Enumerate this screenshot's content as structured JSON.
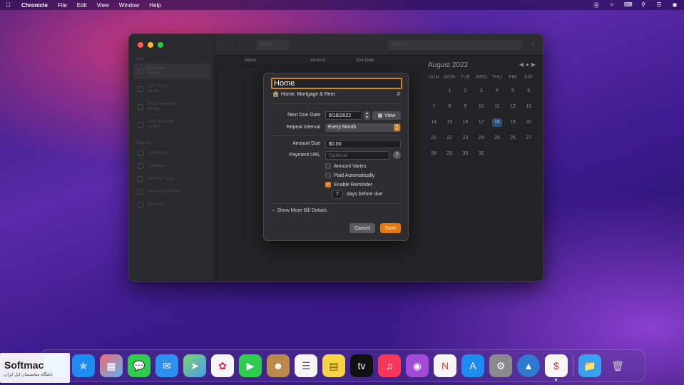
{
  "menubar": {
    "app_name": "Chronicle",
    "items": [
      "File",
      "Edit",
      "View",
      "Window",
      "Help"
    ]
  },
  "sidebar": {
    "section_bills": "Bills",
    "items": [
      {
        "label": "Overdue",
        "sub": "No Bills"
      },
      {
        "label": "Due Soon",
        "sub": "No Bills"
      },
      {
        "label": "Due Thereafter",
        "sub": "No Bills"
      },
      {
        "label": "Paid Recently",
        "sub": "No Bills"
      }
    ],
    "section_reports": "Reports",
    "reports": [
      "Upcoming",
      "Calendar",
      "Monthly Totals",
      "Annual Spending",
      "Balance"
    ]
  },
  "toolbar": {
    "filter_label": "Home",
    "search_placeholder": "Search"
  },
  "list_header": {
    "name": "Name",
    "amount": "Amount",
    "due_date": "Due Date"
  },
  "calendar": {
    "title": "August 2022",
    "weekdays": [
      "SUN",
      "MON",
      "TUE",
      "WED",
      "THU",
      "FRI",
      "SAT"
    ],
    "days": [
      "",
      "1",
      "2",
      "3",
      "4",
      "5",
      "6",
      "7",
      "8",
      "9",
      "10",
      "11",
      "12",
      "13",
      "14",
      "15",
      "16",
      "17",
      "18",
      "19",
      "20",
      "21",
      "22",
      "23",
      "24",
      "25",
      "26",
      "27",
      "28",
      "29",
      "30",
      "31"
    ],
    "highlighted": "18"
  },
  "dialog": {
    "name_value": "Home",
    "category": "Home, Mortgage & Rent",
    "next_due_label": "Next Due Date",
    "next_due_value": "8/18/2022",
    "view_label": "View",
    "repeat_label": "Repeat Interval",
    "repeat_value": "Every Month",
    "amount_label": "Amount Due",
    "amount_value": "$0.00",
    "url_label": "Payment URL",
    "url_placeholder": "Optional",
    "help": "?",
    "amount_varies": "Amount Varies",
    "paid_auto": "Paid Automatically",
    "enable_reminder": "Enable Reminder",
    "reminder_days": "7",
    "days_before": "days before due",
    "more_details": "Show More Bill Details",
    "cancel": "Cancel",
    "save": "Save"
  },
  "watermark": {
    "brand": "Softmac",
    "tagline": "باشگاه متخصصان اپل ایران"
  },
  "colors": {
    "accent": "#e8790f",
    "today": "#2d4e76"
  }
}
